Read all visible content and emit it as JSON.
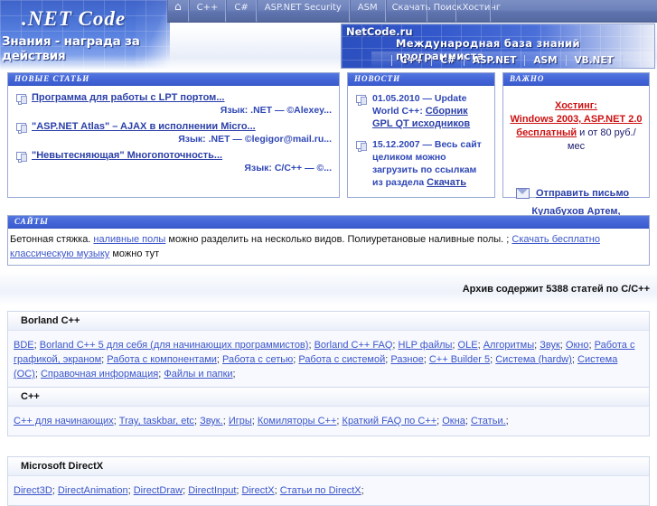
{
  "site": {
    "logo_title": ".NET  Code",
    "logo_slogan": "Знания - награда за действия"
  },
  "topnav": {
    "home_icon": "home-icon",
    "items": [
      {
        "label": "C++"
      },
      {
        "label": "C#"
      },
      {
        "label": "ASP.NET Security"
      },
      {
        "label": "ASM"
      },
      {
        "label": "Скачать"
      },
      {
        "label": "Поиск"
      },
      {
        "label": "Хостинг"
      }
    ]
  },
  "banner": {
    "name": "NetCode.ru",
    "slogan": "Международная база знаний программиста",
    "links": [
      "C++",
      "C#",
      "ASP.NET",
      "ASM",
      "VB.NET"
    ]
  },
  "new_articles": {
    "title": "НОВЫЕ  СТАТЬИ",
    "items": [
      {
        "link": "Программа для работы с LPT портом...",
        "lang": "Язык: .NET — ©Alexey..."
      },
      {
        "link": "\"ASP.NET Atlas\" – AJAX в исполнении Micro...",
        "lang": "Язык: .NET — ©legigor@mail.ru..."
      },
      {
        "link": "\"Невытесняющая\" Многопоточность...",
        "lang": "Язык: C/C++ — ©..."
      }
    ]
  },
  "news": {
    "title": "НОВОСТИ",
    "items": [
      {
        "date": "01.05.2010 — ",
        "text": "Update World C++: ",
        "link": "Сборник GPL QT исходников"
      },
      {
        "date": "15.12.2007 — ",
        "text": "Весь сайт целиком можно загрузить по ссылкам из раздела ",
        "link": "Скачать"
      }
    ]
  },
  "important": {
    "title": "ВАЖНО",
    "host_label": "Хостинг:",
    "host_line": "Windows 2003, ASP.NET 2.0",
    "host_free": "бесплатный",
    "host_price": " и от 80 руб./мес",
    "mail_icon": "envelope-icon",
    "mail_link": "Отправить письмо",
    "author": "Кулабухов Артем, Беларусь"
  },
  "sites": {
    "title": "САЙТЫ",
    "text_1": "Бетонная стяжка. ",
    "link_1": "наливные полы",
    "text_2": " можно разделить на несколько видов. Полиуретановые наливные полы. ; ",
    "link_2": "Скачать бесплатно классическую музыку",
    "text_3": " можно тут"
  },
  "archive": {
    "text": "Архив содержит 5388 статей по C/C++"
  },
  "categories": [
    {
      "title": "Borland C++",
      "links": [
        "BDE",
        "Borland C++ 5 для себя (для начинающих программистов)",
        "Borland C++ FAQ",
        "HLP файлы",
        "OLE",
        "Алгоритмы",
        "Звук",
        "Окно",
        "Работа с графикой, экраном",
        "Работа с компонентами",
        "Работа с сетью",
        "Работа с системой",
        "Разное",
        "C++ Builder 5",
        "Система (hardw)",
        "Система (ОС)",
        "Справочная информация",
        "Файлы и папки"
      ]
    },
    {
      "title": "C++",
      "links": [
        "C++ для начинающих",
        "Tray, taskbar, etc",
        "Звук.",
        "Игры",
        "Комиляторы C++",
        "Краткий FAQ по C++",
        "Окна",
        "Статьи."
      ]
    },
    {
      "title": "Microsoft DirectX",
      "links": [
        "Direct3D",
        "DirectAnimation",
        "DirectDraw",
        "DirectInput",
        "DirectX",
        "Статьи по DirectX"
      ]
    }
  ]
}
